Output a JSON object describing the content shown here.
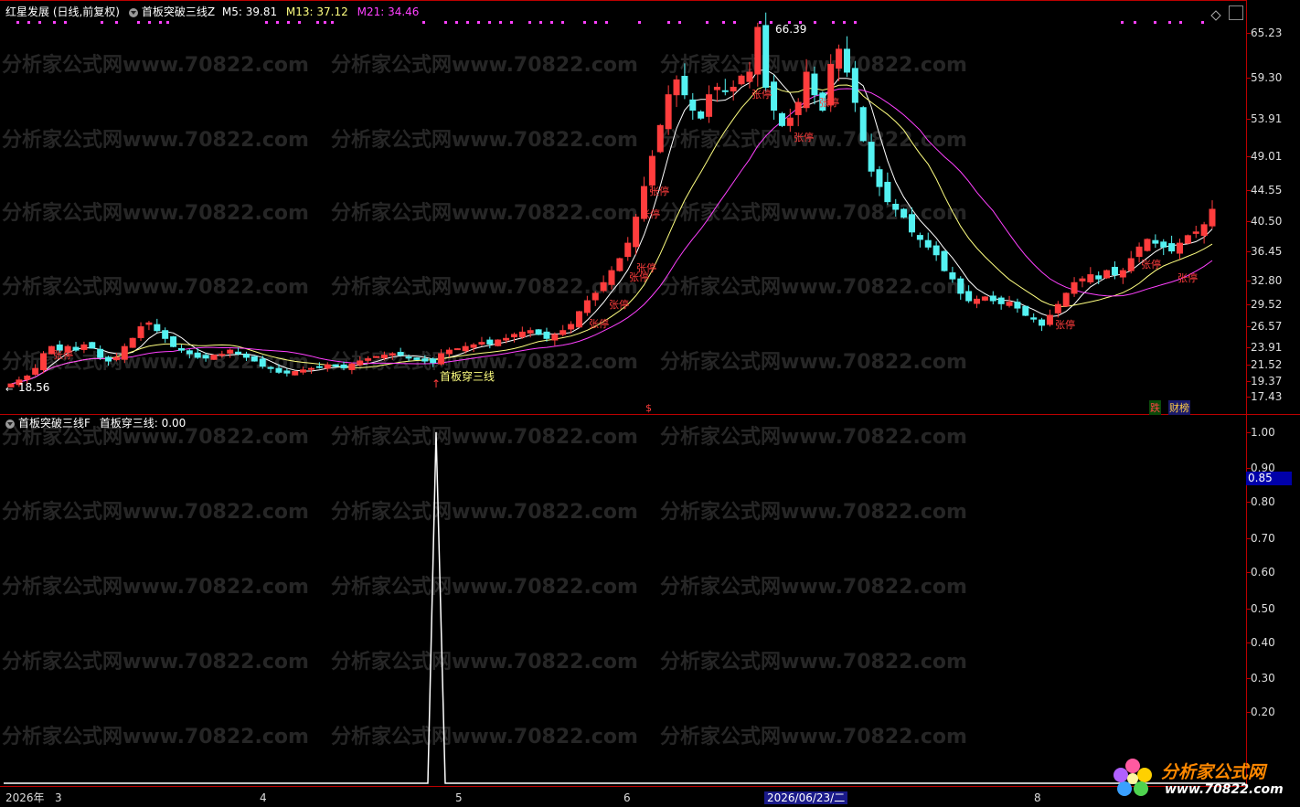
{
  "header": {
    "stock": "红星发展 (日线,前复权)",
    "indicator": "首板突破三线Z",
    "m5": "M5: 39.81",
    "m13": "M13: 37.12",
    "m21": "M21: 34.46"
  },
  "sub_header": {
    "indicator": "首板突破三线F",
    "value": "首板穿三线: 0.00"
  },
  "price_axis": [
    "65.23",
    "59.30",
    "53.91",
    "49.01",
    "44.55",
    "40.50",
    "36.45",
    "32.80",
    "29.52",
    "26.57",
    "23.91",
    "21.52",
    "19.37",
    "17.43"
  ],
  "sub_axis": [
    "1.00",
    "0.90",
    "0.80",
    "0.70",
    "0.60",
    "0.50",
    "0.40",
    "0.30",
    "0.20"
  ],
  "sub_axis_marker": "0.85",
  "annotations": {
    "high_price": "66.39",
    "low_price": "18.56",
    "signal_label": "首板穿三线",
    "limit_up": "张停",
    "dollar": "$",
    "die": "跌",
    "caibang": "财榜"
  },
  "x_axis": {
    "year": "2026年",
    "months": [
      "3",
      "4",
      "5",
      "6",
      "8"
    ],
    "cursor_date": "2026/06/23/二"
  },
  "watermark": "分析家公式网www.70822.com",
  "logo": {
    "title": "分析家公式网",
    "url": "www.70822.com"
  },
  "colors": {
    "up": "#ff3d3d",
    "down": "#54f2f2",
    "m5": "#ffffff",
    "m13": "#ffff80",
    "m21": "#ff40ff",
    "signal": "#ffffff"
  }
}
